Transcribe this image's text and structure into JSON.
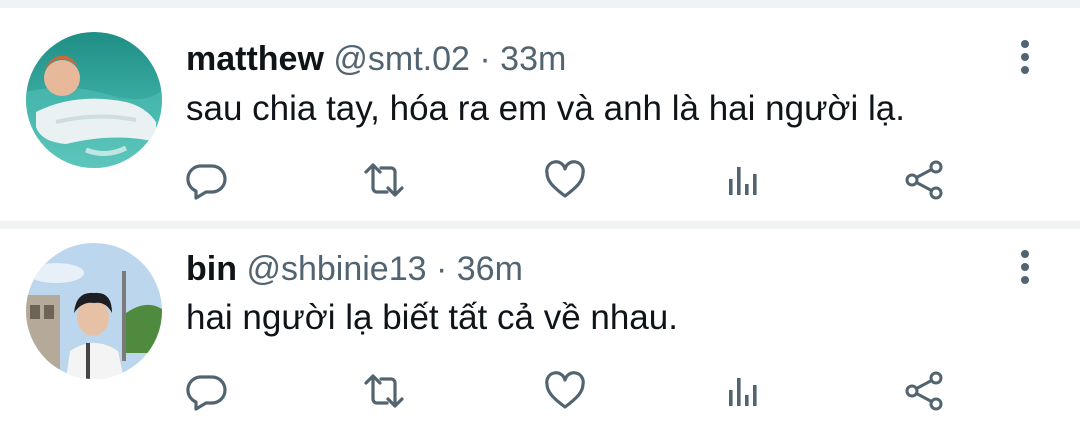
{
  "colors": {
    "text": "#0f1419",
    "secondary": "#536471",
    "icon": "#536471",
    "divider": "#eff3f4"
  },
  "tweets": [
    {
      "name": "matthew",
      "handle": "@smt.02",
      "separator": "·",
      "time": "33m",
      "text": "sau chia tay, hóa ra em và anh là hai người lạ."
    },
    {
      "name": "bin",
      "handle": "@shbinie13",
      "separator": "·",
      "time": "36m",
      "text": "hai người lạ biết tất cả về nhau."
    }
  ],
  "icons": [
    "more-vertical-icon",
    "reply-icon",
    "retweet-icon",
    "like-icon",
    "analytics-icon",
    "share-icon"
  ]
}
